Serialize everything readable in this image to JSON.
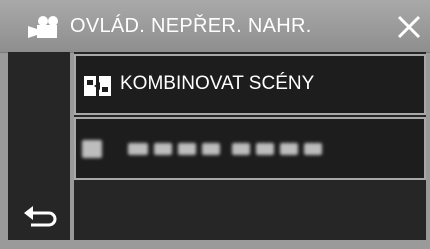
{
  "header": {
    "title": "OVLÁD. NEPŘER. NAHR.",
    "title_icon": "video-camera-icon",
    "close_icon": "close-icon"
  },
  "menu": {
    "items": [
      {
        "label": "KOMBINOVAT SCÉNY",
        "icon": "combine-scenes-icon"
      }
    ]
  },
  "footer": {
    "back_icon": "back-arrow-icon"
  },
  "colors": {
    "frame": "#9a9a9a",
    "panel": "#262626",
    "item_border": "#a8a8a8",
    "text": "#ffffff"
  }
}
